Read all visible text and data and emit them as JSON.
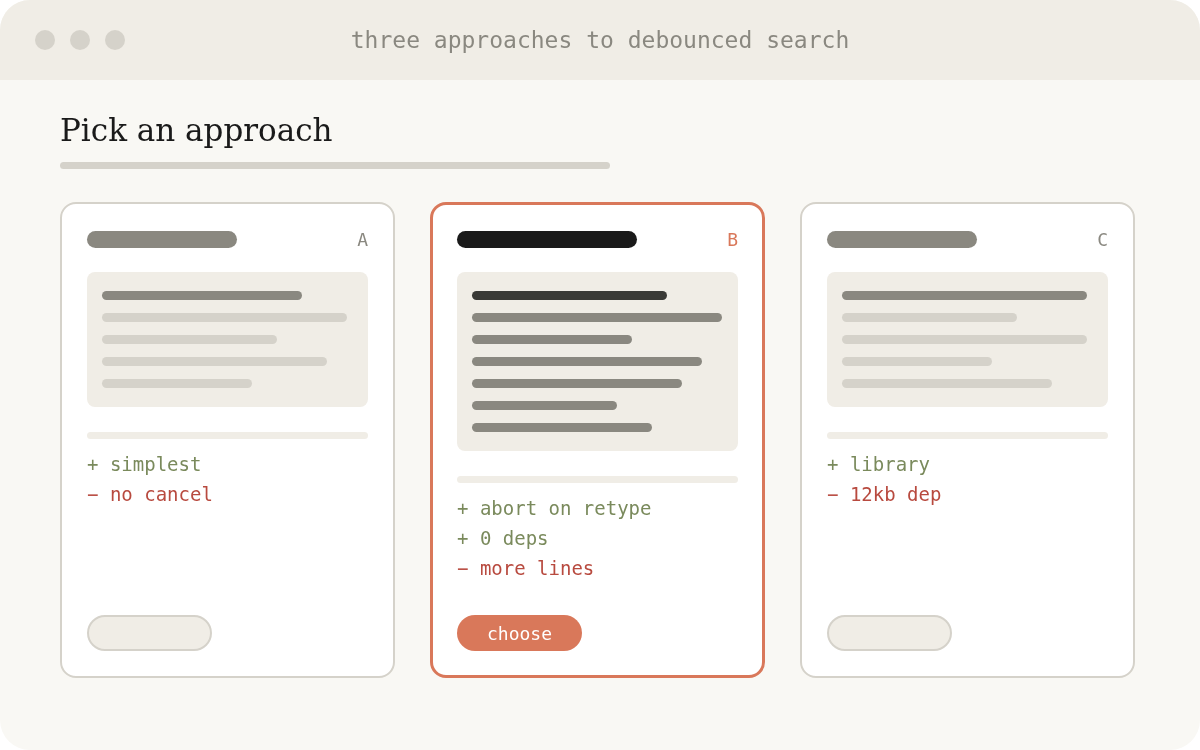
{
  "window": {
    "title": "three approaches to debounced search"
  },
  "heading": "Pick an approach",
  "cards": [
    {
      "letter": "A",
      "selected": false,
      "points": [
        {
          "kind": "pro",
          "text": "+ simplest"
        },
        {
          "kind": "con",
          "text": "− no cancel"
        }
      ]
    },
    {
      "letter": "B",
      "selected": true,
      "points": [
        {
          "kind": "pro",
          "text": "+ abort on retype"
        },
        {
          "kind": "pro",
          "text": "+ 0 deps"
        },
        {
          "kind": "con",
          "text": "− more lines"
        }
      ],
      "button": "choose"
    },
    {
      "letter": "C",
      "selected": false,
      "points": [
        {
          "kind": "pro",
          "text": "+ library"
        },
        {
          "kind": "con",
          "text": "− 12kb dep"
        }
      ]
    }
  ]
}
